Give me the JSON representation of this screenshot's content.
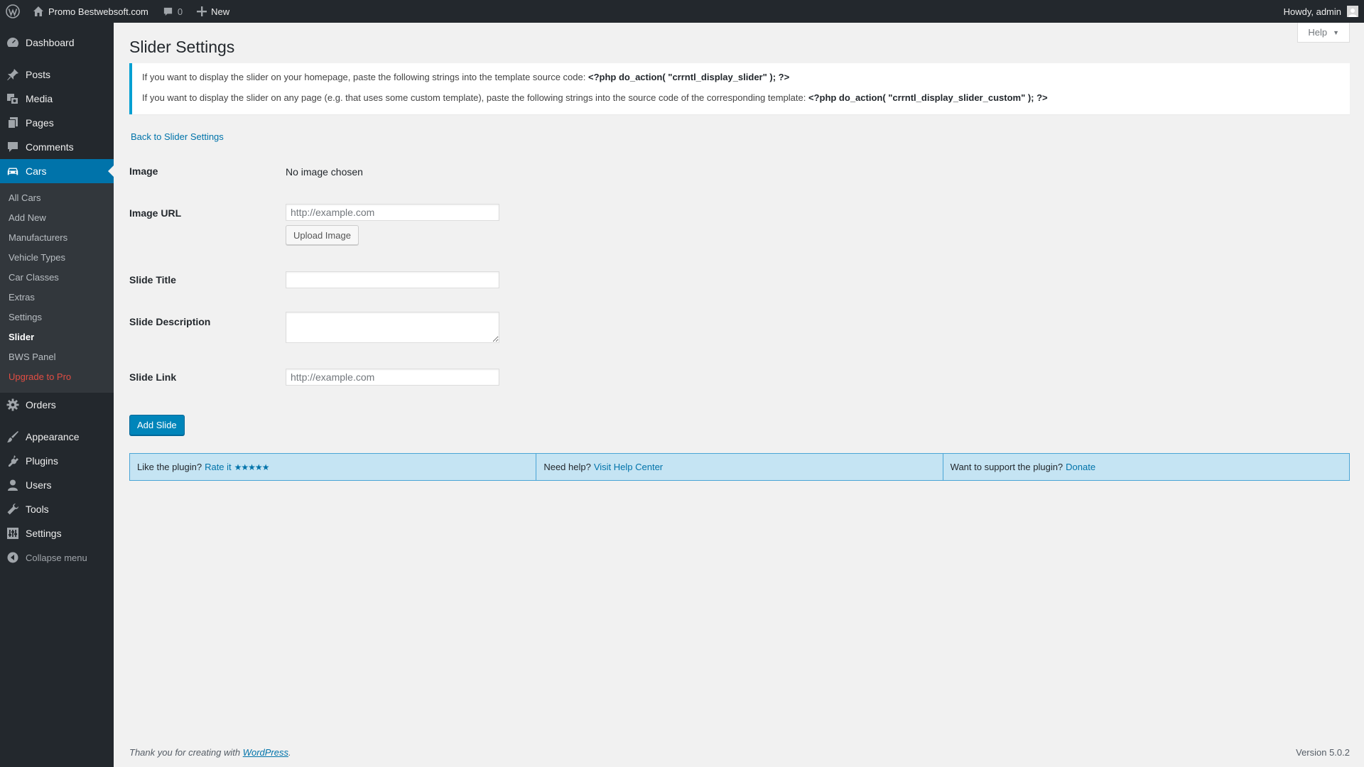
{
  "adminbar": {
    "site_name": "Promo Bestwebsoft.com",
    "comments_count": "0",
    "new_label": "New",
    "howdy": "Howdy, admin"
  },
  "menu": {
    "dashboard": "Dashboard",
    "posts": "Posts",
    "media": "Media",
    "pages": "Pages",
    "comments": "Comments",
    "cars": "Cars",
    "cars_sub": [
      "All Cars",
      "Add New",
      "Manufacturers",
      "Vehicle Types",
      "Car Classes",
      "Extras",
      "Settings",
      "Slider",
      "BWS Panel",
      "Upgrade to Pro"
    ],
    "orders": "Orders",
    "appearance": "Appearance",
    "plugins": "Plugins",
    "users": "Users",
    "tools": "Tools",
    "settings": "Settings",
    "collapse": "Collapse menu"
  },
  "help_tab": "Help",
  "page_title": "Slider Settings",
  "notice": {
    "line1_text": "If you want to display the slider on your homepage, paste the following strings into the template source code: ",
    "line1_code": "<?php do_action( \"crrntl_display_slider\" ); ?>",
    "line2_text": "If you want to display the slider on any page (e.g. that uses some custom template), paste the following strings into the source code of the corresponding template: ",
    "line2_code": "<?php do_action( \"crrntl_display_slider_custom\" ); ?>"
  },
  "back_link": "Back to Slider Settings",
  "form": {
    "image_label": "Image",
    "image_value": "No image chosen",
    "image_url_label": "Image URL",
    "image_url_placeholder": "http://example.com",
    "upload_button": "Upload Image",
    "slide_title_label": "Slide Title",
    "slide_title_value": "",
    "slide_description_label": "Slide Description",
    "slide_link_label": "Slide Link",
    "slide_link_placeholder": "http://example.com",
    "add_button": "Add Slide"
  },
  "bws_bar": {
    "like_text": "Like the plugin?",
    "rate_link": "Rate it",
    "stars": "★★★★★",
    "help_text": "Need help?",
    "help_link": "Visit Help Center",
    "support_text": "Want to support the plugin?",
    "donate_link": "Donate"
  },
  "footer": {
    "thanks_prefix": "Thank you for creating with ",
    "thanks_link": "WordPress",
    "thanks_suffix": ".",
    "version": "Version 5.0.2"
  }
}
